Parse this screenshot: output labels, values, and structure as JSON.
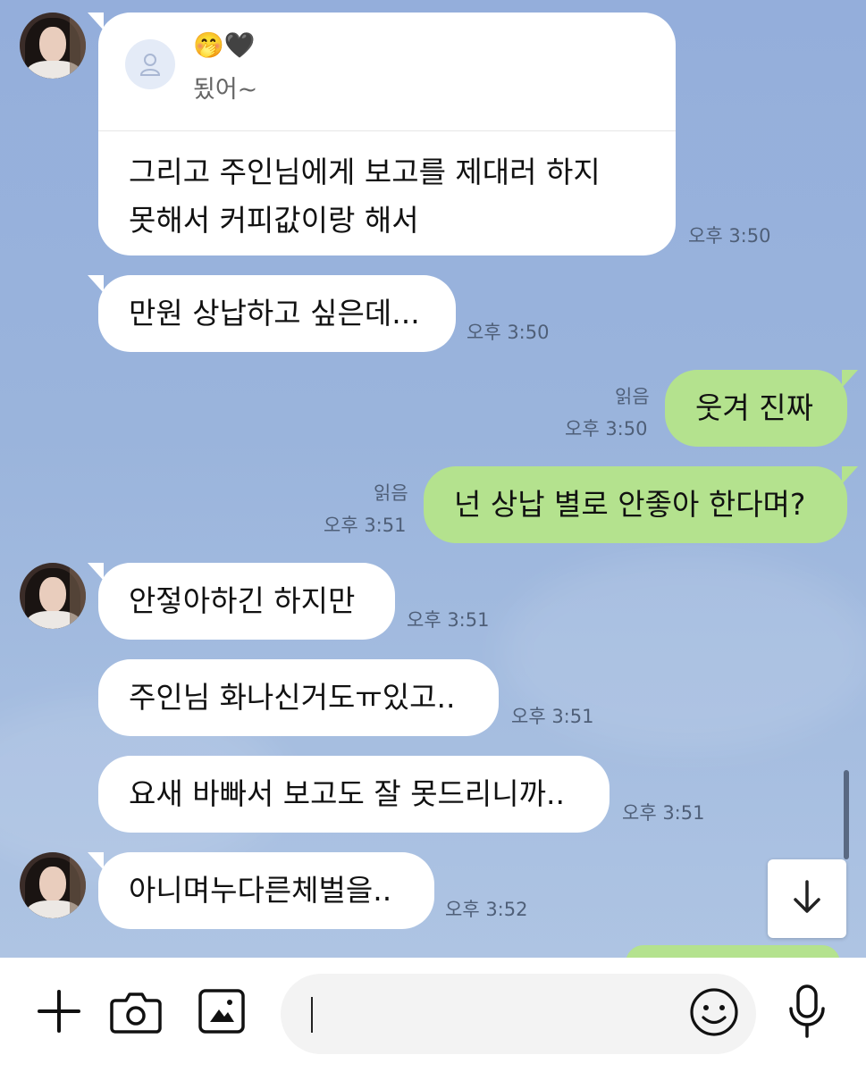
{
  "quoted": {
    "emoji": "🤭🖤",
    "text": "됬어~",
    "message": "그리고 주인님에게 보고를 제대러 하지\n못해서 커피값이랑 해서",
    "time": "오후 3:50"
  },
  "messages": [
    {
      "side": "in",
      "text": "만원 상납하고 싶은데...",
      "time": "오후 3:50"
    },
    {
      "side": "out",
      "text": "웃겨 진짜",
      "time": "오후 3:50",
      "read": "읽음"
    },
    {
      "side": "out",
      "text": "넌 상납 별로 안좋아 한다며?",
      "time": "오후 3:51",
      "read": "읽음"
    },
    {
      "side": "in",
      "text": "안젛아하긴 하지만",
      "time": "오후 3:51"
    },
    {
      "side": "in",
      "text": "주인님 화나신거도ㅠ있고..",
      "time": "오후 3:51"
    },
    {
      "side": "in",
      "text": "요새 바빠서 보고도 잘 못드리니까..",
      "time": "오후 3:51"
    },
    {
      "side": "in",
      "text": "아니며누다른체벌을..",
      "time": "오후 3:52"
    }
  ],
  "input": {
    "placeholder": ""
  },
  "icons": {
    "attach": "plus-icon",
    "camera": "camera-icon",
    "gallery": "image-icon",
    "emoji": "smiley-icon",
    "voice": "microphone-icon",
    "scroll": "arrow-down-icon"
  },
  "colors": {
    "background": "#9bb4da",
    "incoming_bubble": "#ffffff",
    "outgoing_bubble": "#b4e28e"
  }
}
